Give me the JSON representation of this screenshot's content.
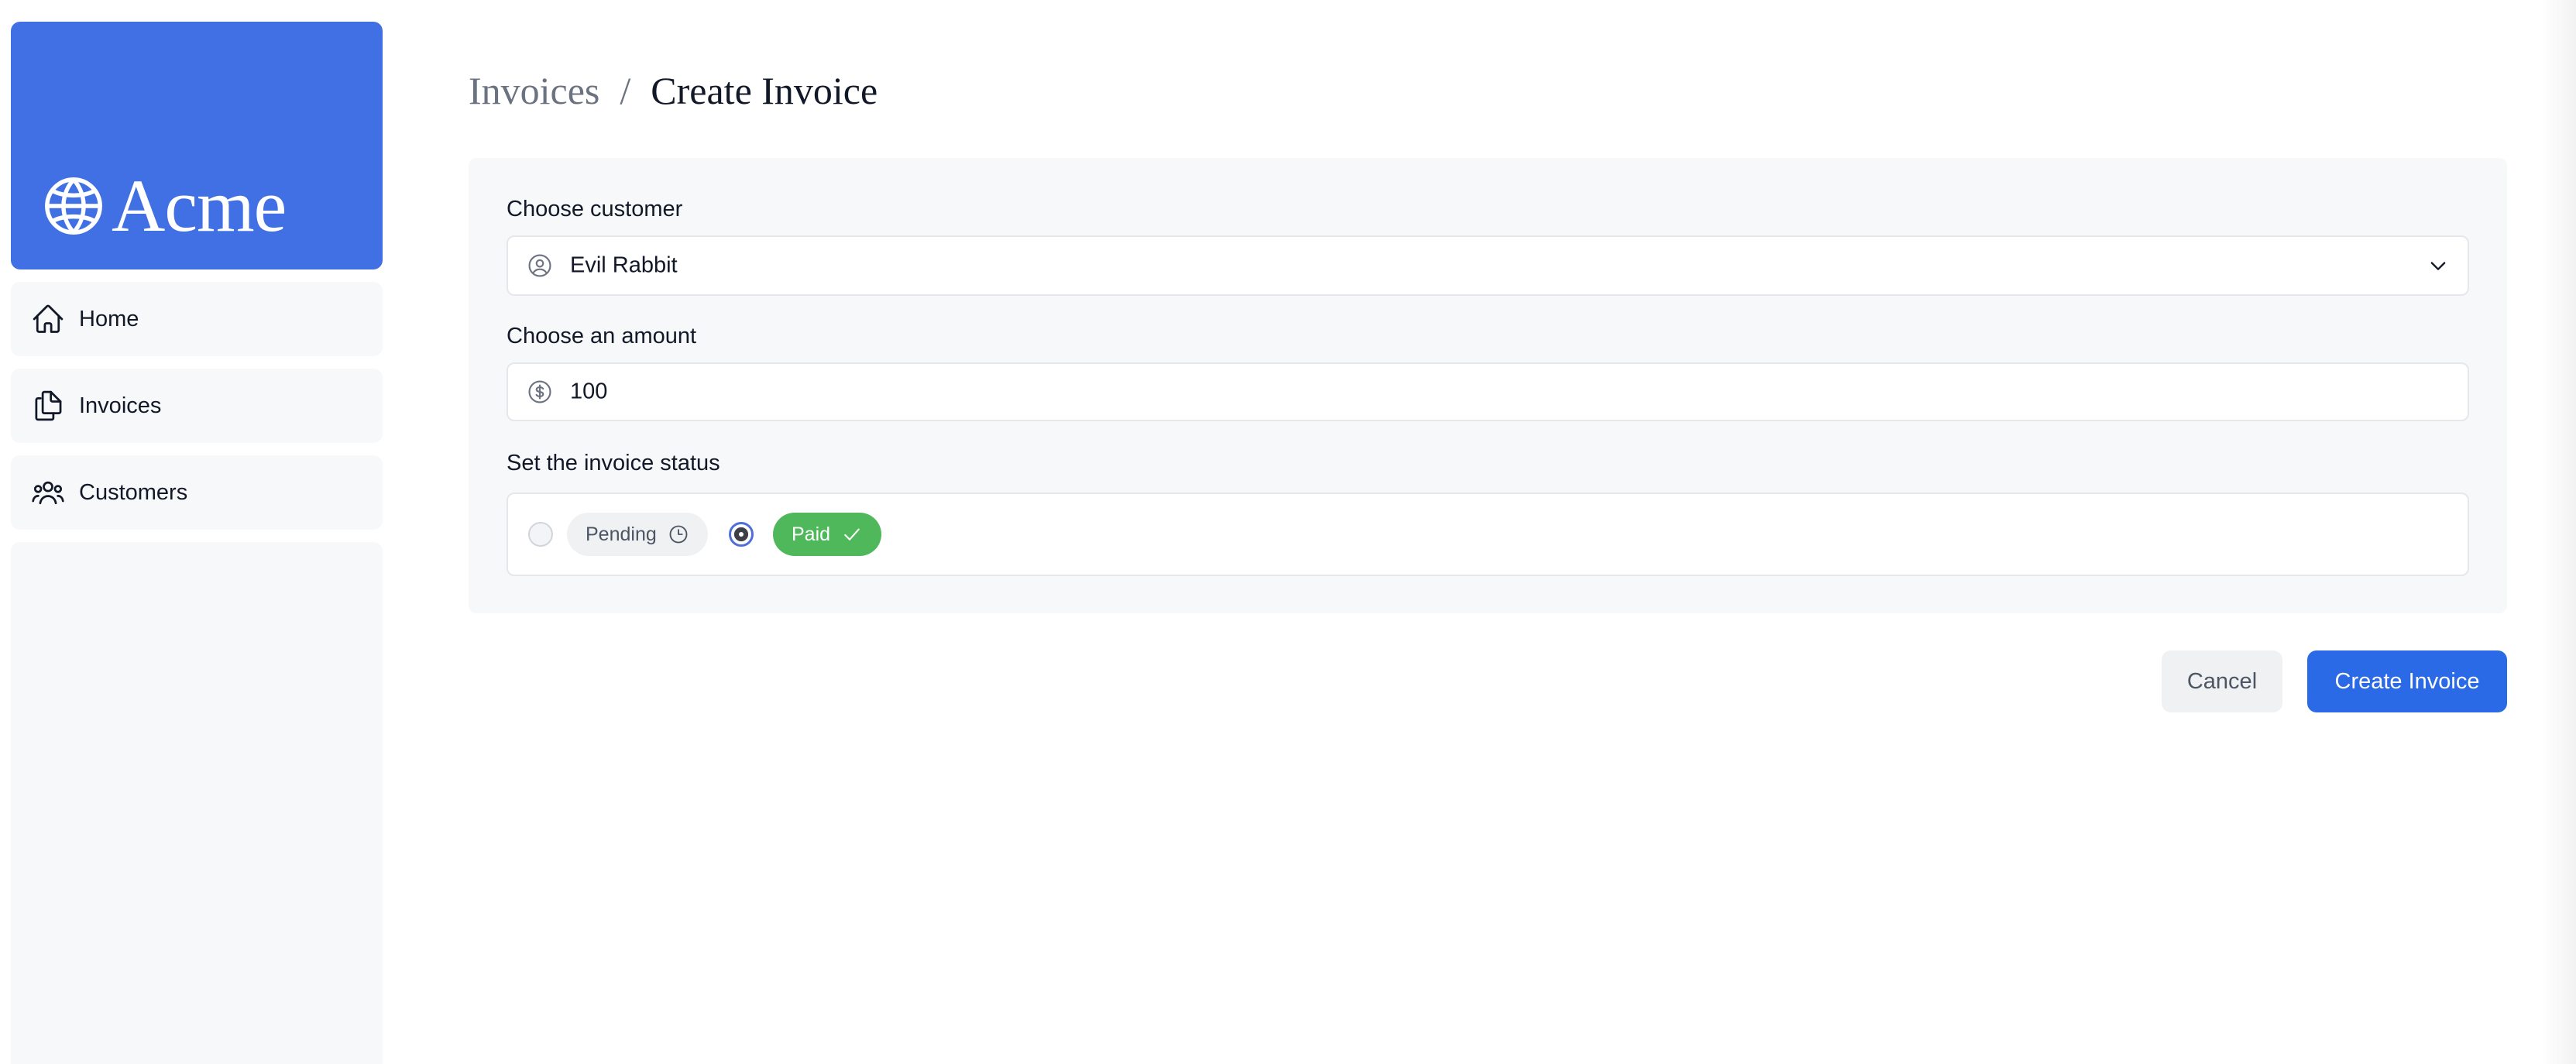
{
  "brand": {
    "name": "Acme",
    "color": "#4070e3"
  },
  "sidebar": {
    "items": [
      {
        "label": "Home",
        "icon": "home-icon"
      },
      {
        "label": "Invoices",
        "icon": "document-duplicate-icon"
      },
      {
        "label": "Customers",
        "icon": "user-group-icon"
      }
    ]
  },
  "breadcrumb": {
    "parent": "Invoices",
    "separator": "/",
    "current": "Create Invoice"
  },
  "form": {
    "customer": {
      "label": "Choose customer",
      "value": "Evil Rabbit",
      "icon": "user-circle-icon"
    },
    "amount": {
      "label": "Choose an amount",
      "value": "100",
      "icon": "currency-dollar-icon"
    },
    "status": {
      "label": "Set the invoice status",
      "options": [
        {
          "label": "Pending",
          "icon": "clock-icon",
          "selected": false
        },
        {
          "label": "Paid",
          "icon": "check-icon",
          "selected": true,
          "color": "#4fb85b"
        }
      ]
    }
  },
  "actions": {
    "cancel": "Cancel",
    "create": "Create Invoice",
    "primary_color": "#2a6ae7"
  }
}
